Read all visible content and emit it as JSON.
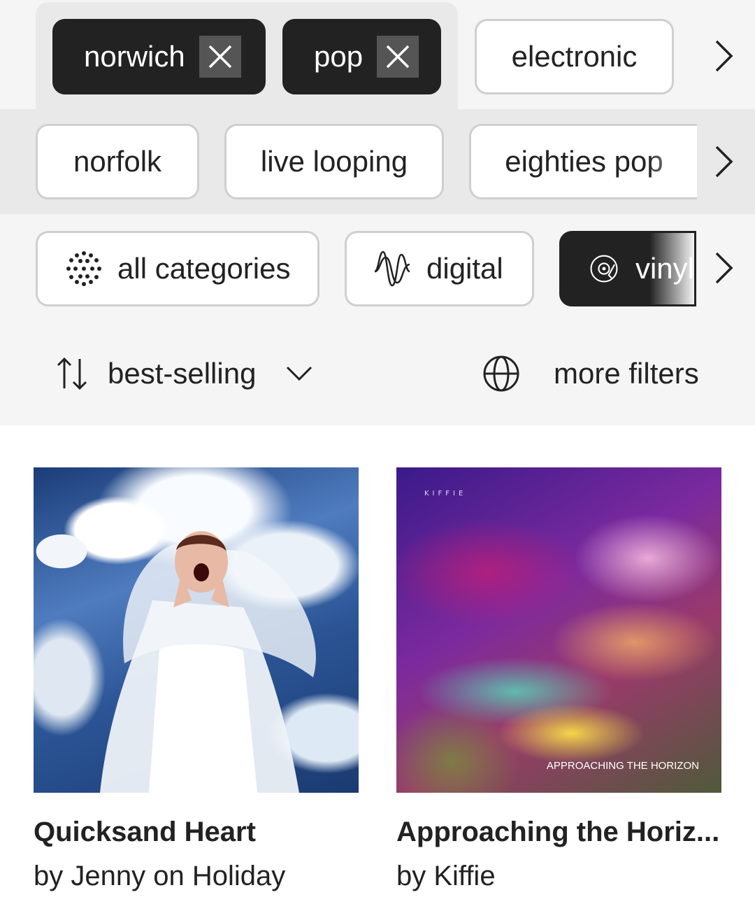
{
  "selected_tags": [
    {
      "label": "norwich"
    },
    {
      "label": "pop"
    }
  ],
  "tag_row1_suggestions": [
    {
      "label": "electronic"
    }
  ],
  "tag_row2": [
    {
      "label": "norfolk"
    },
    {
      "label": "live looping"
    },
    {
      "label": "eighties pop"
    }
  ],
  "formats": {
    "all": {
      "label": "all categories",
      "icon": "dots-grid-icon"
    },
    "digital": {
      "label": "digital",
      "icon": "waveform-icon"
    },
    "vinyl": {
      "label": "vinyl",
      "icon": "record-player-icon",
      "selected": true
    }
  },
  "sort": {
    "label": "best-selling",
    "icon": "sort-arrows-icon"
  },
  "more_filters": {
    "label": "more filters",
    "icon": "globe-icon"
  },
  "results": [
    {
      "title": "Quicksand Heart",
      "artist": "by Jenny on Holiday"
    },
    {
      "title": "Approaching the Horiz...",
      "artist": "by Kiffie",
      "cover_brand": "KIFFIE",
      "cover_caption": "APPROACHING THE HORIZON"
    }
  ],
  "colors": {
    "selected_chip_bg": "#222222",
    "chip_border": "#cfcfcf",
    "page_bg": "#f5f5f5"
  }
}
